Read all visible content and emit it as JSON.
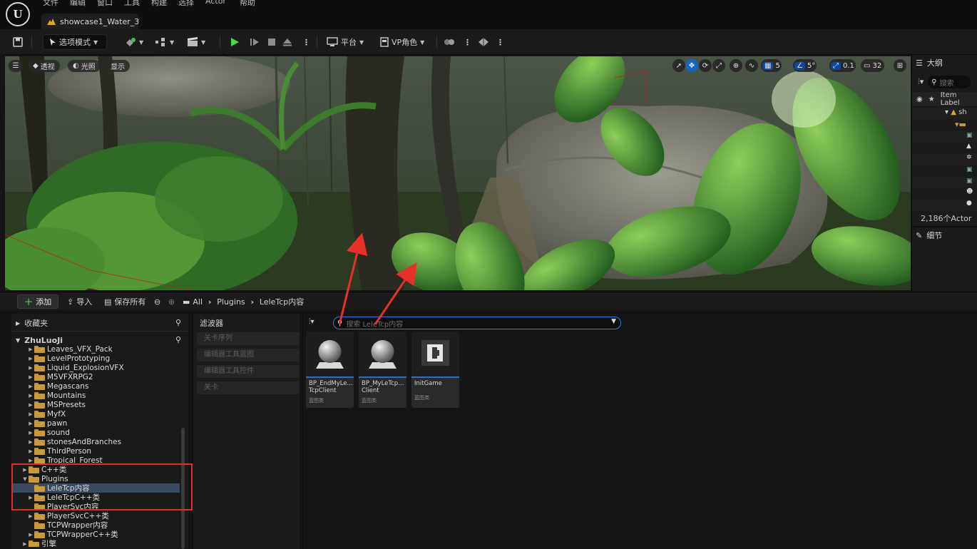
{
  "menubar": {
    "items": [
      "文件",
      "编辑",
      "窗口",
      "工具",
      "构建",
      "选择",
      "Actor",
      "帮助"
    ]
  },
  "app": {
    "logo": "U"
  },
  "tab": {
    "level_name": "showcase1_Water_3"
  },
  "toolbar": {
    "mode_label": "选项模式",
    "platform_label": "平台",
    "vp_role_label": "VP角色"
  },
  "viewport": {
    "perspective_label": "透视",
    "lighting_label": "光照",
    "show_label": "显示",
    "grid_snap_value": "5",
    "rotation_snap_value": "5°",
    "scale_snap_value": "0.1",
    "camera_speed_value": "32"
  },
  "outliner": {
    "title": "大纲",
    "search_placeholder": "搜索",
    "column_label": "Item Label",
    "root_item": "sh",
    "actor_count": "2,186个Actor"
  },
  "details": {
    "title": "细节"
  },
  "content_browser": {
    "add_label": "添加",
    "import_label": "导入",
    "save_all_label": "保存所有",
    "breadcrumb": [
      "All",
      "Plugins",
      "LeleTcp内容"
    ],
    "favorites_label": "收藏夹",
    "project_label": "ZhuLuoJi",
    "filters_title": "滤波器",
    "filters": [
      "关卡序列",
      "编辑器工具蓝图",
      "编辑器工具控件",
      "关卡"
    ],
    "search_placeholder": "搜索 LeleTcp内容",
    "tree": [
      {
        "label": "Leaves_VFX_Pack",
        "arrow": "▶"
      },
      {
        "label": "LevelPrototyping",
        "arrow": "▶"
      },
      {
        "label": "Liquid_ExplosionVFX",
        "arrow": "▶"
      },
      {
        "label": "M5VFXRPG2",
        "arrow": "▶"
      },
      {
        "label": "Megascans",
        "arrow": "▶"
      },
      {
        "label": "Mountains",
        "arrow": "▶"
      },
      {
        "label": "MSPresets",
        "arrow": "▶"
      },
      {
        "label": "MyfX",
        "arrow": "▶"
      },
      {
        "label": "pawn",
        "arrow": "▶"
      },
      {
        "label": "sound",
        "arrow": "▶"
      },
      {
        "label": "stonesAndBranches",
        "arrow": "▶"
      },
      {
        "label": "ThirdPerson",
        "arrow": "▶"
      },
      {
        "label": "Tropical_Forest",
        "arrow": "▶"
      },
      {
        "label": "C++类",
        "arrow": "▶"
      },
      {
        "label": "Plugins",
        "arrow": "▼"
      },
      {
        "label": "LeleTcp内容",
        "arrow": ""
      },
      {
        "label": "LeleTcpC++类",
        "arrow": "▶"
      },
      {
        "label": "PlayerSvc内容",
        "arrow": ""
      },
      {
        "label": "PlayerSvcC++类",
        "arrow": "▶"
      },
      {
        "label": "TCPWrapper内容",
        "arrow": ""
      },
      {
        "label": "TCPWrapperC++类",
        "arrow": "▶"
      },
      {
        "label": "引擎",
        "arrow": "▶"
      }
    ],
    "assets": [
      {
        "name": "BP_EndMyLe... TcpClient",
        "type": "蓝图类"
      },
      {
        "name": "BP_MyLeTcp... Client",
        "type": "蓝图类"
      },
      {
        "name": "InitGame",
        "type": "蓝图类"
      }
    ]
  }
}
